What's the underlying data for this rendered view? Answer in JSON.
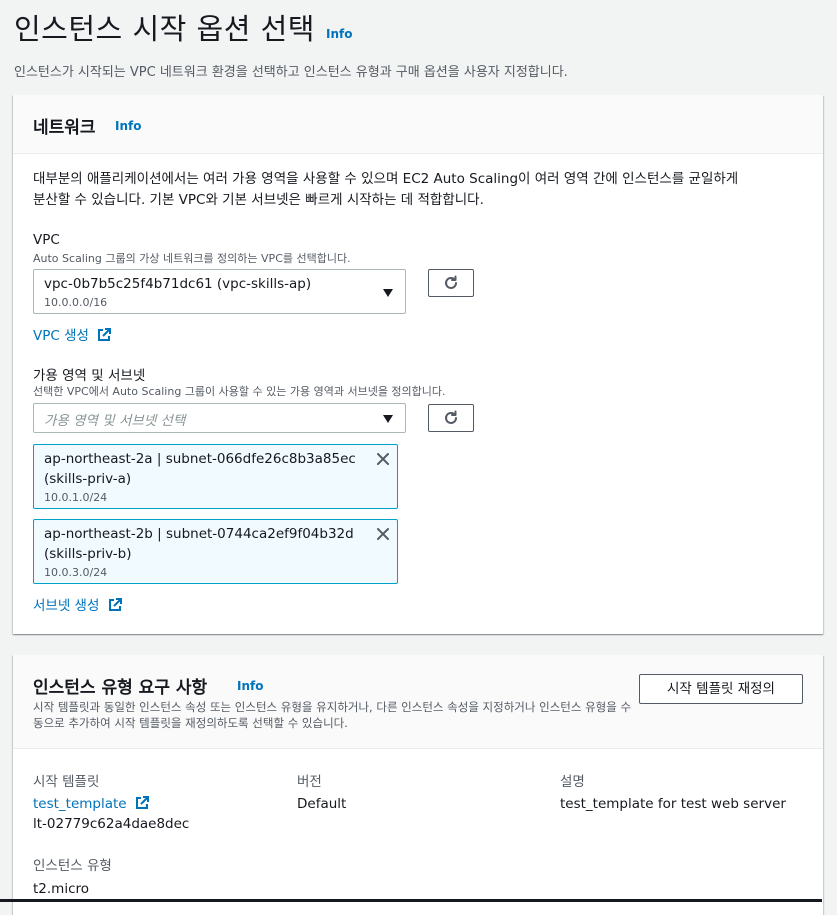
{
  "page": {
    "title": "인스턴스 시작 옵션 선택",
    "info": "Info",
    "description": "인스턴스가 시작되는 VPC 네트워크 환경을 선택하고 인스턴스 유형과 구매 옵션을 사용자 지정합니다."
  },
  "network": {
    "title": "네트워크",
    "info": "Info",
    "description_line1": "대부분의 애플리케이션에서는 여러 가용 영역을 사용할 수 있으며 EC2 Auto Scaling이 여러 영역 간에 인스턴스를 균일하게",
    "description_line2": "분산할 수 있습니다. 기본 VPC와 기본 서브넷은 빠르게 시작하는 데 적합합니다.",
    "vpc": {
      "label": "VPC",
      "sublabel": "Auto Scaling 그룹의 가상 네트워크를 정의하는 VPC를 선택합니다.",
      "selected": "vpc-0b7b5c25f4b71dc61 (vpc-skills-ap)",
      "selected_cidr": "10.0.0.0/16",
      "create_link": "VPC 생성"
    },
    "subnets": {
      "label": "가용 영역 및 서브넷",
      "sublabel": "선택한 VPC에서 Auto Scaling 그룹이 사용할 수 있는 가용 영역과 서브넷을 정의합니다.",
      "placeholder": "가용 영역 및 서브넷 선택",
      "tokens": [
        {
          "line1": "ap-northeast-2a | subnet-066dfe26c8b3a85ec",
          "line2": "(skills-priv-a)",
          "cidr": "10.0.1.0/24"
        },
        {
          "line1": "ap-northeast-2b | subnet-0744ca2ef9f04b32d",
          "line2": "(skills-priv-b)",
          "cidr": "10.0.3.0/24"
        }
      ],
      "create_link": "서브넷 생성"
    }
  },
  "instance_requirements": {
    "title": "인스턴스 유형 요구 사항",
    "info": "Info",
    "description": "시작 템플릿과 동일한 인스턴스 속성 또는 인스턴스 유형을 유지하거나, 다른 인스턴스 속성을 지정하거나 인스턴스 유형을 수동으로 추가하여 시작 템플릿을 재정의하도록 선택할 수 있습니다.",
    "override_button": "시작 템플릿 재정의",
    "launch_template_label": "시작 템플릿",
    "launch_template_name": "test_template",
    "launch_template_id": "lt-02779c62a4dae8dec",
    "version_label": "버전",
    "version_value": "Default",
    "description_label": "설명",
    "description_value": "test_template for test web server",
    "instance_type_label": "인스턴스 유형",
    "instance_type_value": "t2.micro"
  },
  "colors": {
    "link": "#0073bb",
    "token_bg": "#f1faff",
    "token_border": "#00a1c9",
    "page_bg": "#f2f3f3"
  }
}
